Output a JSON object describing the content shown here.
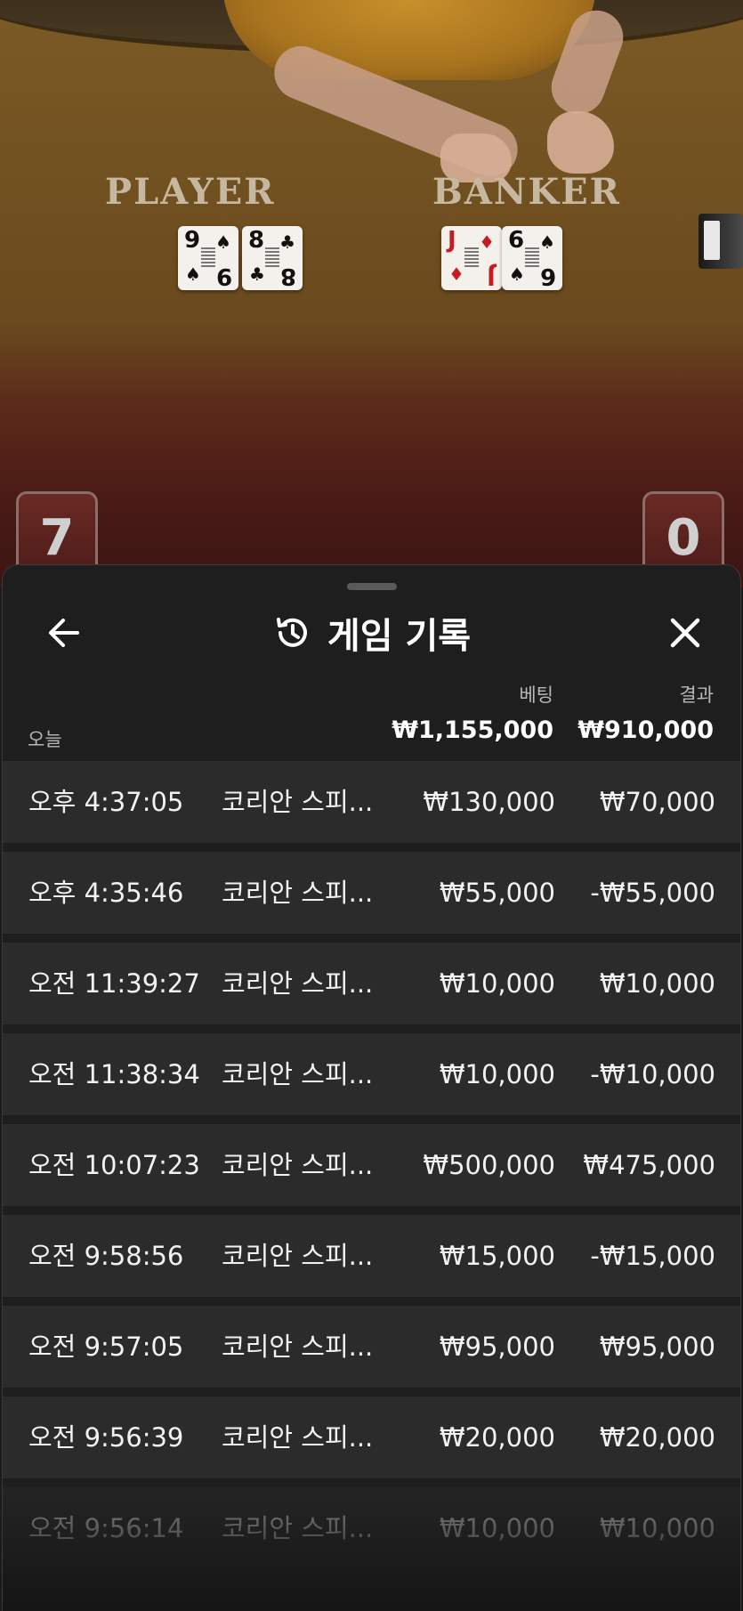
{
  "table": {
    "player_label": "PLAYER",
    "banker_label": "BANKER",
    "player_cards": [
      {
        "rank": "9",
        "suit": "♠",
        "color": "black"
      },
      {
        "rank": "8",
        "suit": "♣",
        "color": "black"
      }
    ],
    "banker_cards": [
      {
        "rank": "J",
        "suit": "♦",
        "color": "red"
      },
      {
        "rank": "6",
        "suit": "♠",
        "color": "black"
      }
    ],
    "player_score": "7",
    "banker_score": "0"
  },
  "panel": {
    "title": "게임 기록",
    "title_icon": "history-icon",
    "back_icon": "arrow-left-icon",
    "close_icon": "close-icon",
    "bet_header": "베팅",
    "result_header": "결과",
    "date_label": "오늘",
    "total_bet": "₩1,155,000",
    "total_result": "₩910,000"
  },
  "rows": [
    {
      "time": "오후 4:37:05",
      "game": "코리안 스피...",
      "bet": "₩130,000",
      "result": "₩70,000"
    },
    {
      "time": "오후 4:35:46",
      "game": "코리안 스피...",
      "bet": "₩55,000",
      "result": "-₩55,000"
    },
    {
      "time": "오전 11:39:27",
      "game": "코리안 스피...",
      "bet": "₩10,000",
      "result": "₩10,000"
    },
    {
      "time": "오전 11:38:34",
      "game": "코리안 스피...",
      "bet": "₩10,000",
      "result": "-₩10,000"
    },
    {
      "time": "오전 10:07:23",
      "game": "코리안 스피...",
      "bet": "₩500,000",
      "result": "₩475,000"
    },
    {
      "time": "오전 9:58:56",
      "game": "코리안 스피...",
      "bet": "₩15,000",
      "result": "-₩15,000"
    },
    {
      "time": "오전 9:57:05",
      "game": "코리안 스피...",
      "bet": "₩95,000",
      "result": "₩95,000"
    },
    {
      "time": "오전 9:56:39",
      "game": "코리안 스피...",
      "bet": "₩20,000",
      "result": "₩20,000"
    },
    {
      "time": "오전 9:56:14",
      "game": "코리안 스피...",
      "bet": "₩10,000",
      "result": "₩10,000"
    }
  ],
  "colors": {
    "panel_bg": "#1e1e1e",
    "row_bg": "#2b2b2b",
    "text_primary": "#ffffff",
    "text_secondary": "#b8b8b8"
  }
}
